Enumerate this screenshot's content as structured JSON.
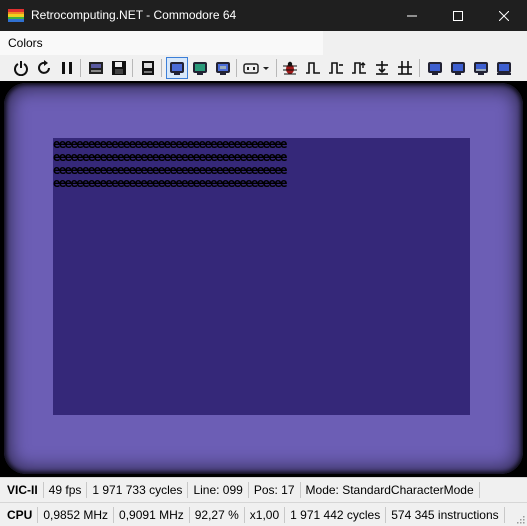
{
  "window": {
    "title": "Retrocomputing.NET - Commodore 64",
    "minimize_icon": "minimize-icon",
    "maximize_icon": "maximize-icon",
    "close_icon": "close-icon"
  },
  "menu": {
    "items": [
      {
        "label": "Colors"
      }
    ]
  },
  "toolbar": {
    "icons": [
      "power-icon",
      "reset-icon",
      "pause-icon",
      "tape-icon",
      "floppy-icon",
      "cartridge-icon",
      "monitor-icon",
      "monitor-icon",
      "monitor-icon",
      "joystick-dropdown-icon",
      "bug-icon",
      "step-icon",
      "step-over-icon",
      "step-out-icon",
      "step-into-icon",
      "run-to-icon",
      "display-icon",
      "display-icon",
      "display-icon",
      "display-icon"
    ]
  },
  "screen": {
    "border_color": "#6c5eb5",
    "background_color": "#352879",
    "char_rows": [
      "eeeeeeeeeeeeeeeeeeeeeeeeeeeeeeeeeeeeeeee",
      "eeeeeeeeeeeeeeeeeeeeeeeeeeeeeeeeeeeeeeee",
      "eeeeeeeeeeeeeeeeeeeeeeeeeeeeeeeeeeeeeeee",
      "eeeeeeeeeeeeeeeeeeeeeeeeeeeeeeeeeeeeeeee"
    ]
  },
  "status": {
    "vic": {
      "label": "VIC-II",
      "fps": "49 fps",
      "cycles": "1 971 733 cycles",
      "line": "Line: 099",
      "pos": "Pos: 17",
      "mode": "Mode: StandardCharacterMode"
    },
    "cpu": {
      "label": "CPU",
      "freq": "0,9852 MHz",
      "effective": "0,9091 MHz",
      "percent": "92,27 %",
      "speed": "x1,00",
      "cycles": "1 971 442 cycles",
      "instructions": "574 345 instructions"
    }
  }
}
